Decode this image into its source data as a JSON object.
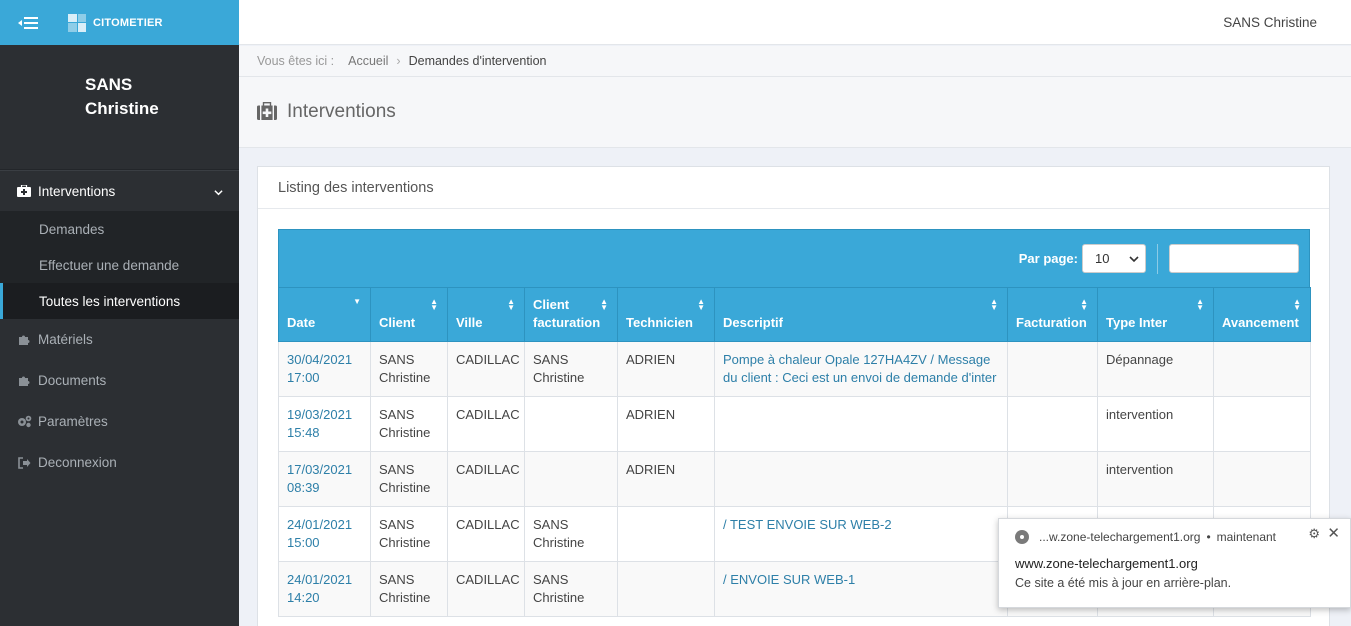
{
  "brand": {
    "name": "CITOMETIER"
  },
  "user": {
    "name": "SANS Christine"
  },
  "sidebar": {
    "items": [
      {
        "label": "Interventions",
        "icon": "medkit-icon",
        "open": true,
        "sub": [
          {
            "label": "Demandes"
          },
          {
            "label": "Effectuer une demande"
          },
          {
            "label": "Toutes les interventions",
            "active": true
          }
        ]
      },
      {
        "label": "Matériels",
        "icon": "puzzle-icon"
      },
      {
        "label": "Documents",
        "icon": "puzzle-icon"
      },
      {
        "label": "Paramètres",
        "icon": "gears-icon"
      },
      {
        "label": "Deconnexion",
        "icon": "sign-out-icon"
      }
    ]
  },
  "breadcrumb": {
    "prefix": "Vous êtes ici :",
    "home": "Accueil",
    "current": "Demandes d'intervention"
  },
  "page": {
    "title": "Interventions"
  },
  "panel": {
    "heading": "Listing des interventions"
  },
  "toolbar": {
    "per_page_label": "Par page:",
    "per_page_value": "10",
    "search_placeholder": ""
  },
  "table": {
    "columns": [
      "Date",
      "Client",
      "Ville",
      "Client facturation",
      "Technicien",
      "Descriptif",
      "Facturation",
      "Type Inter",
      "Avancement"
    ],
    "rows": [
      [
        "30/04/2021 17:00",
        "SANS Christine",
        "CADILLAC",
        "SANS Christine",
        "ADRIEN",
        "Pompe à chaleur Opale 127HA4ZV / Message du client : Ceci est un envoi de demande d'inter",
        "",
        "Dépannage",
        ""
      ],
      [
        "19/03/2021 15:48",
        "SANS Christine",
        "CADILLAC",
        "",
        "ADRIEN",
        "",
        "",
        "intervention",
        ""
      ],
      [
        "17/03/2021 08:39",
        "SANS Christine",
        "CADILLAC",
        "",
        "ADRIEN",
        "",
        "",
        "intervention",
        ""
      ],
      [
        "24/01/2021 15:00",
        "SANS Christine",
        "CADILLAC",
        "SANS Christine",
        "",
        "/ TEST ENVOIE SUR WEB-2",
        "",
        "",
        ""
      ],
      [
        "24/01/2021 14:20",
        "SANS Christine",
        "CADILLAC",
        "SANS Christine",
        "",
        "/ ENVOIE SUR WEB-1",
        "",
        "",
        ""
      ]
    ]
  },
  "notification": {
    "source": "...w.zone-telechargement1.org",
    "time": "maintenant",
    "title": "www.zone-telechargement1.org",
    "body": "Ce site a été mis à jour en arrière-plan."
  },
  "colors": {
    "accent": "#3aa8d8",
    "sidebar": "#2c2f33"
  }
}
